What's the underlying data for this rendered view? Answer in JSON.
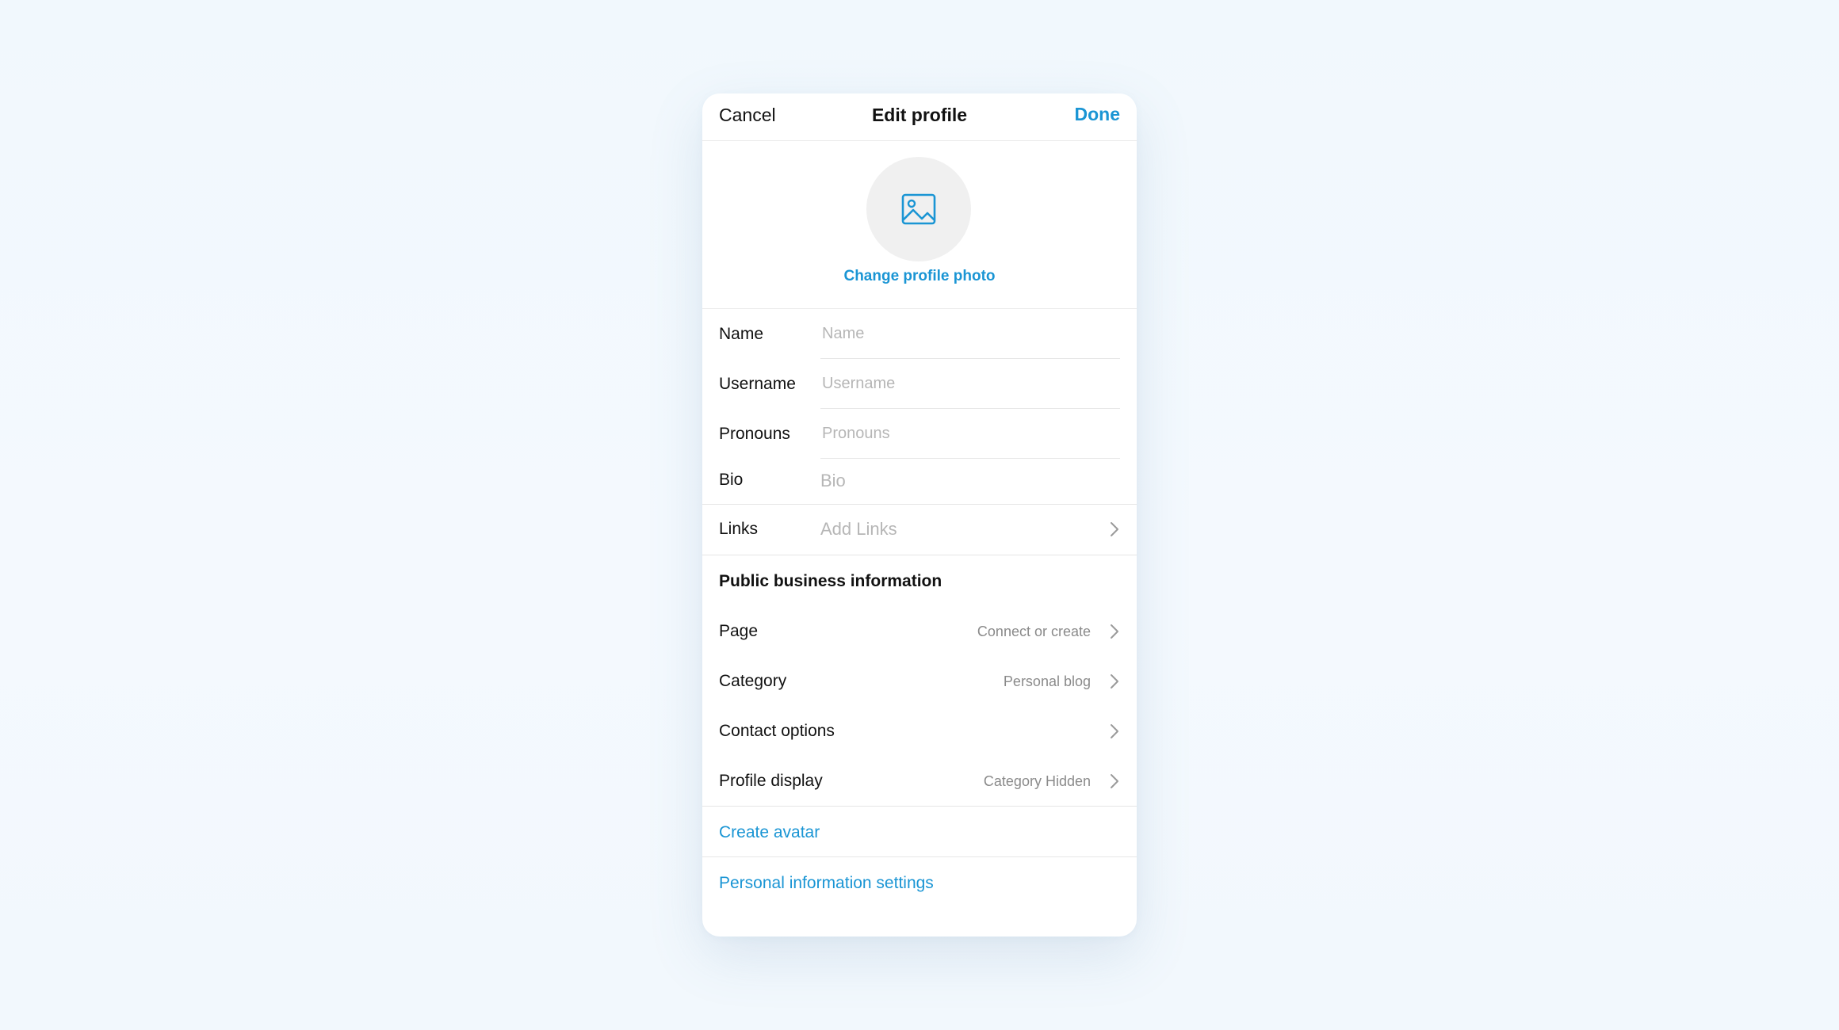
{
  "colors": {
    "accent": "#1a95d4",
    "background": "#f3f9fe",
    "card": "#ffffff"
  },
  "header": {
    "cancel_label": "Cancel",
    "title": "Edit profile",
    "done_label": "Done"
  },
  "photo": {
    "icon": "image-icon",
    "change_label": "Change profile photo"
  },
  "fields": {
    "name": {
      "label": "Name",
      "placeholder": "Name",
      "value": ""
    },
    "username": {
      "label": "Username",
      "placeholder": "Username",
      "value": ""
    },
    "pronouns": {
      "label": "Pronouns",
      "placeholder": "Pronouns",
      "value": ""
    },
    "bio": {
      "label": "Bio",
      "placeholder": "Bio",
      "value": ""
    }
  },
  "links": {
    "label": "Links",
    "value": "Add Links",
    "icon": "chevron-right-icon"
  },
  "business": {
    "title": "Public business information",
    "rows": [
      {
        "label": "Page",
        "value": "Connect or create"
      },
      {
        "label": "Category",
        "value": "Personal blog"
      },
      {
        "label": "Contact options",
        "value": ""
      },
      {
        "label": "Profile display",
        "value": "Category Hidden"
      }
    ]
  },
  "actions": {
    "create_avatar": "Create avatar",
    "personal_info": "Personal information settings"
  }
}
